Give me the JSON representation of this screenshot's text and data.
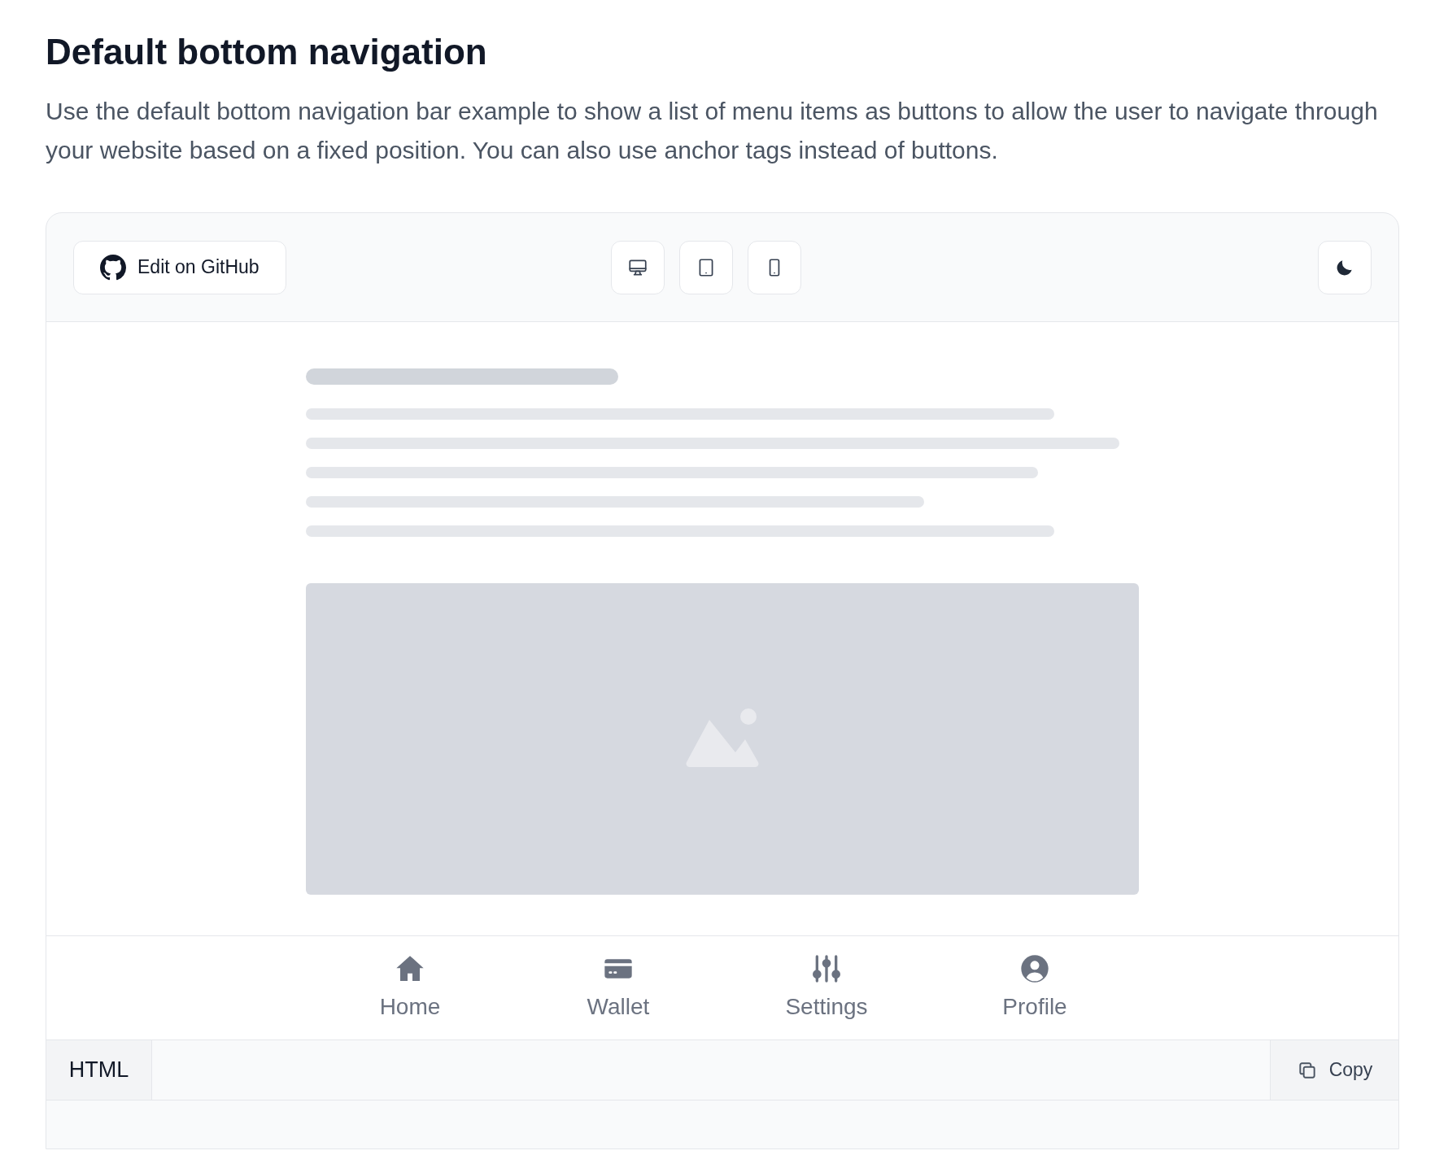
{
  "heading": "Default bottom navigation",
  "description": "Use the default bottom navigation bar example to show a list of menu items as buttons to allow the user to navigate through your website based on a fixed position. You can also use anchor tags instead of buttons.",
  "toolbar": {
    "edit_button": "Edit on GitHub",
    "devices": [
      {
        "kind": "desktop"
      },
      {
        "kind": "tablet"
      },
      {
        "kind": "mobile"
      }
    ]
  },
  "nav_items": [
    {
      "label": "Home",
      "kind": "home"
    },
    {
      "label": "Wallet",
      "kind": "wallet"
    },
    {
      "label": "Settings",
      "kind": "settings"
    },
    {
      "label": "Profile",
      "kind": "profile"
    }
  ],
  "code_bar": {
    "tab": "HTML",
    "copy_button": "Copy"
  }
}
